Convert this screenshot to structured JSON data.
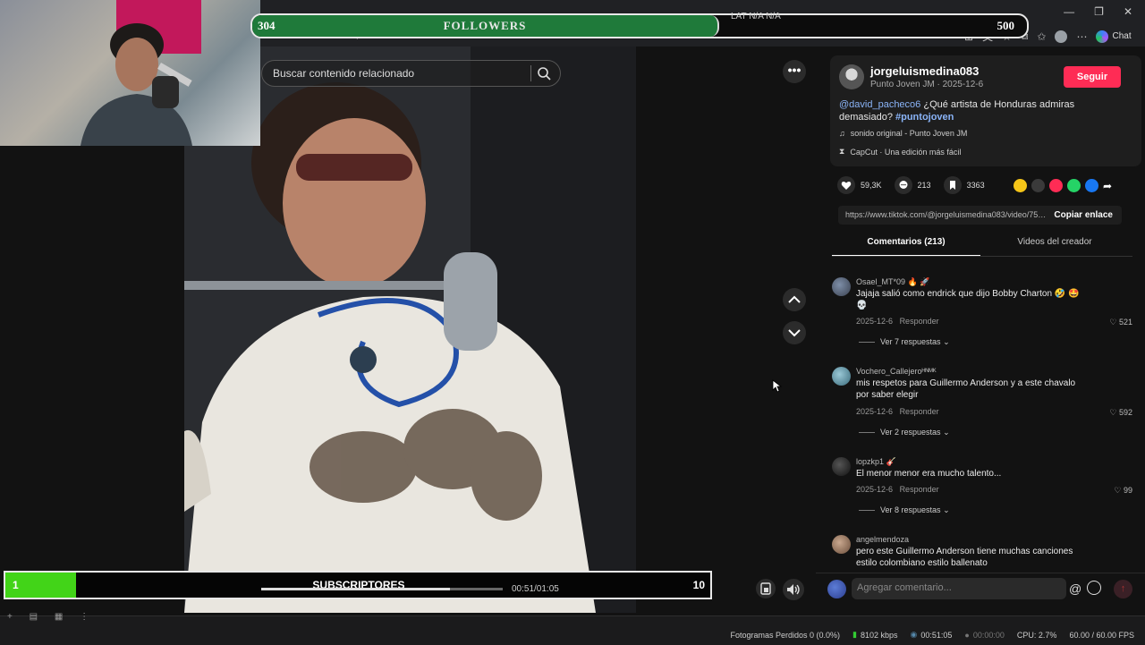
{
  "overlay": {
    "followers": {
      "min": "304",
      "title": "FOLLOWERS",
      "max": "500",
      "progress_fraction": 0.6
    },
    "lat": {
      "label": "LAT",
      "value1": "N/A",
      "value2": "N/A"
    },
    "subscribers": {
      "min": "1",
      "title": "SUBSCRIPTORES",
      "max": "10",
      "progress_fraction": 0.1
    }
  },
  "browser": {
    "url_fragment": "36f825287388798804?q=artistas%20hondurenos&t=1772591018053",
    "chat_label": "Chat",
    "window_controls": [
      "minimize-icon",
      "restore-icon",
      "close-icon"
    ]
  },
  "player": {
    "search_placeholder": "Buscar contenido relacionado",
    "more_label": "•••",
    "time": "00:51/01:05",
    "progress_fraction": 0.78
  },
  "video_card": {
    "username": "jorgeluismedina083",
    "subline": "Punto Joven JM · 2025-12-6",
    "follow_label": "Seguir",
    "caption": {
      "mention": "@david_pacheco6",
      "text": " ¿Qué artista de Honduras admiras demasiado? ",
      "hashtag": "#puntojoven"
    },
    "sound": "sonido original - Punto Joven JM",
    "capcut": "CapCut · Una edición más fácil",
    "likes": "59,3K",
    "comments_count": "213",
    "saves": "3363",
    "link": "https://www.tiktok.com/@jorgeluismedina083/video/7581136825287388790",
    "copy_link_label": "Copiar enlace",
    "share_colors": [
      "#f5c518",
      "#3a3a3a",
      "#fe2c55",
      "#25d366",
      "#1877f2"
    ]
  },
  "tabs": {
    "comments": "Comentarios (213)",
    "videos": "Videos del creador"
  },
  "comments": [
    {
      "user": "Osael_MT*09 🔥 🚀",
      "text": "Jajaja salió como endrick que dijo Bobby Charton 🤣 🤩 💀",
      "date": "2025-12-6",
      "reply": "Responder",
      "likes": "521",
      "replies": "Ver 7 respuestas"
    },
    {
      "user": "Vochero_Callejeroᴴᴺᴹᴷ",
      "text": "mis respetos para Guillermo Anderson y a este chavalo por saber elegir",
      "date": "2025-12-6",
      "reply": "Responder",
      "likes": "592",
      "replies": "Ver 2 respuestas"
    },
    {
      "user": "lopzkp1 🎸",
      "text": "El menor menor era mucho talento...",
      "date": "2025-12-6",
      "reply": "Responder",
      "likes": "99",
      "replies": "Ver 8 respuestas"
    },
    {
      "user": "angelmendoza",
      "text": "pero este Guillermo Anderson tiene muchas canciones estilo colombiano estilo ballenato"
    }
  ],
  "comment_input": {
    "placeholder": "Agregar comentario...",
    "at": "@"
  },
  "obs_status": {
    "dropped": "Fotogramas Perdidos 0 (0.0%)",
    "bitrate": "8102 kbps",
    "stream_time": "00:51:05",
    "rec_time": "00:00:00",
    "cpu": "CPU: 2.7%",
    "fps": "60.00 / 60.00 FPS"
  }
}
